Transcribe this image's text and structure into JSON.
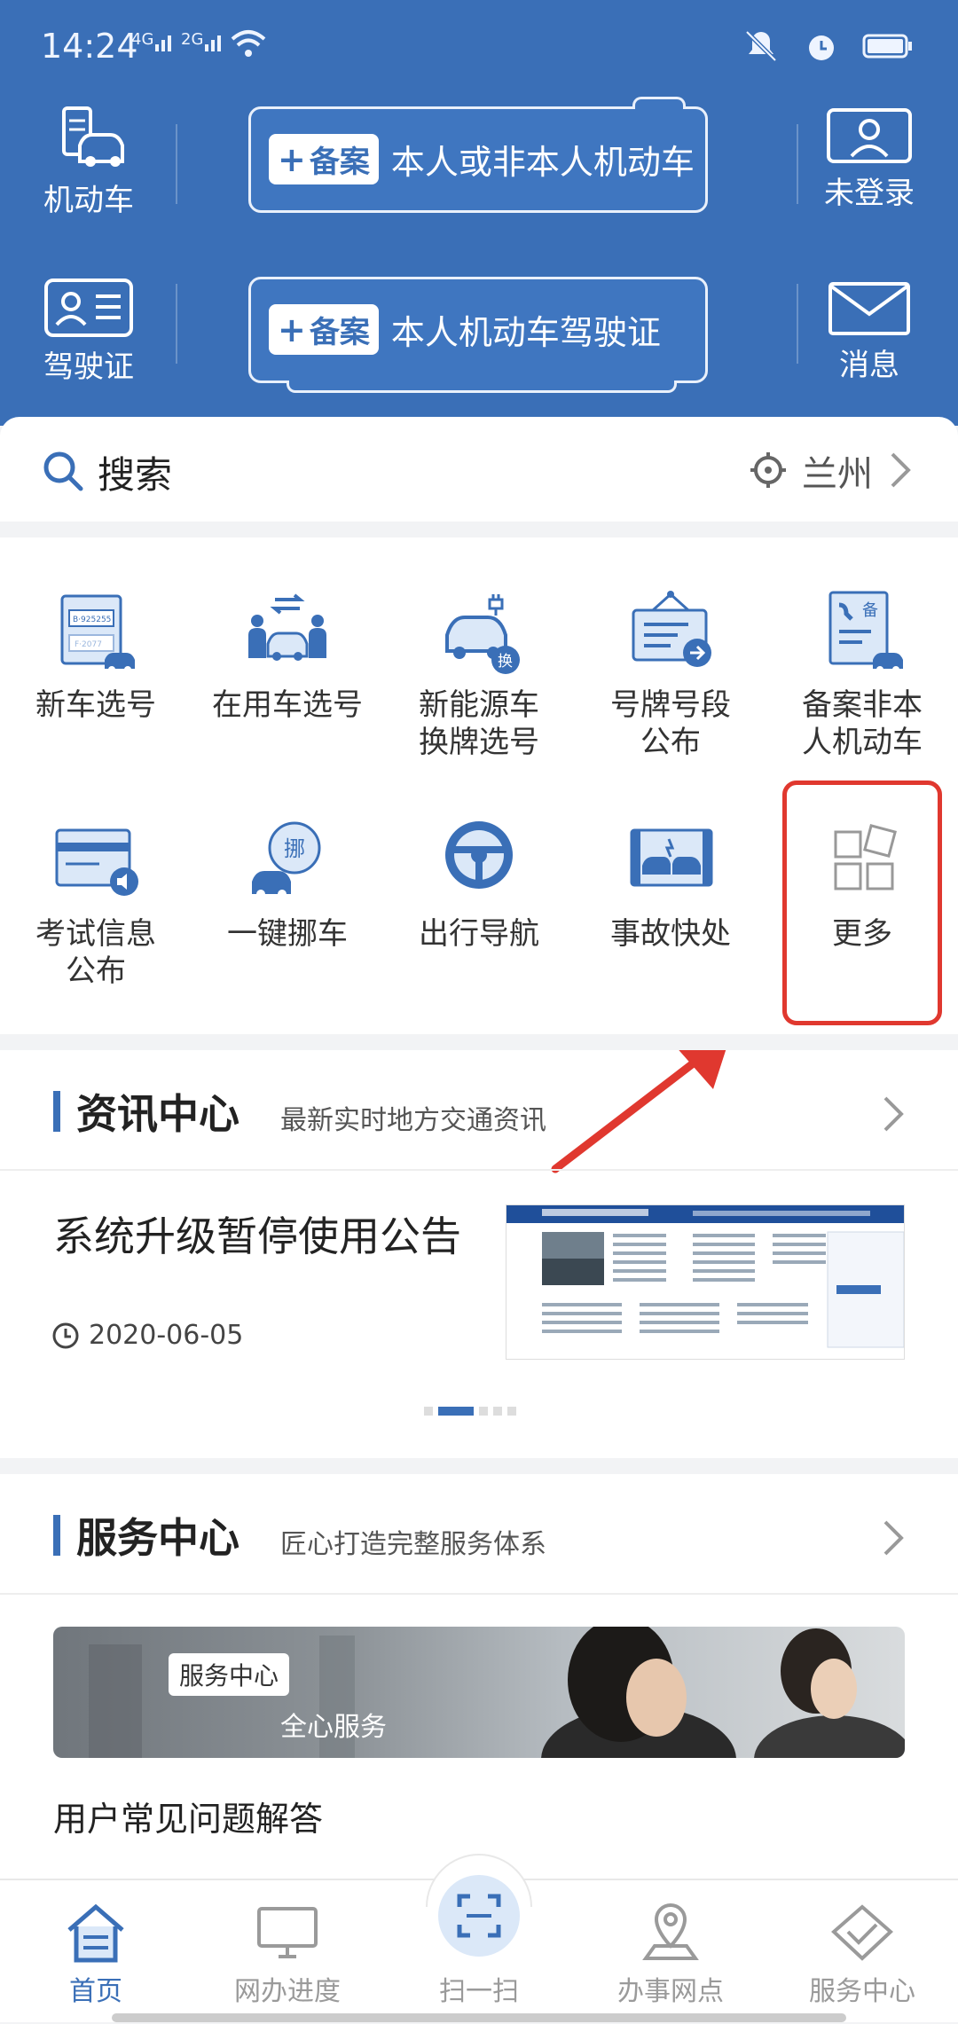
{
  "status_bar": {
    "time": "14:24",
    "sig1": "4G",
    "sig2": "2G"
  },
  "header": {
    "vehicle_label": "机动车",
    "license_label": "驾驶证",
    "login_label": "未登录",
    "message_label": "消息",
    "card1": {
      "badge": "备案",
      "text": "本人或非本人机动车"
    },
    "card2": {
      "badge": "备案",
      "text": "本人机动车驾驶证"
    }
  },
  "search": {
    "placeholder": "搜索",
    "city": "兰州"
  },
  "services": [
    {
      "label": "新车选号"
    },
    {
      "label": "在用车选号"
    },
    {
      "label": "新能源车换牌选号"
    },
    {
      "label": "号牌号段公布"
    },
    {
      "label": "备案非本人机动车"
    },
    {
      "label": "考试信息公布"
    },
    {
      "label": "一键挪车"
    },
    {
      "label": "出行导航"
    },
    {
      "label": "事故快处"
    },
    {
      "label": "更多"
    }
  ],
  "icon_text": {
    "plate1": "B·925255",
    "plate2": "F·2077",
    "swap": "换",
    "move": "挪",
    "beian": "备"
  },
  "news": {
    "title": "资讯中心",
    "subtitle": "最新实时地方交通资讯",
    "item_title": "系统升级暂停使用公告",
    "item_date": "2020-06-05"
  },
  "service_center": {
    "title": "服务中心",
    "subtitle": "匠心打造完整服务体系",
    "banner_tag": "服务中心",
    "banner_text": "全心服务",
    "faq": "用户常见问题解答"
  },
  "tabs": [
    {
      "label": "首页"
    },
    {
      "label": "网办进度"
    },
    {
      "label": "扫一扫"
    },
    {
      "label": "办事网点"
    },
    {
      "label": "服务中心"
    }
  ],
  "colors": {
    "primary": "#3a6fb7",
    "highlight": "#e0382f"
  }
}
